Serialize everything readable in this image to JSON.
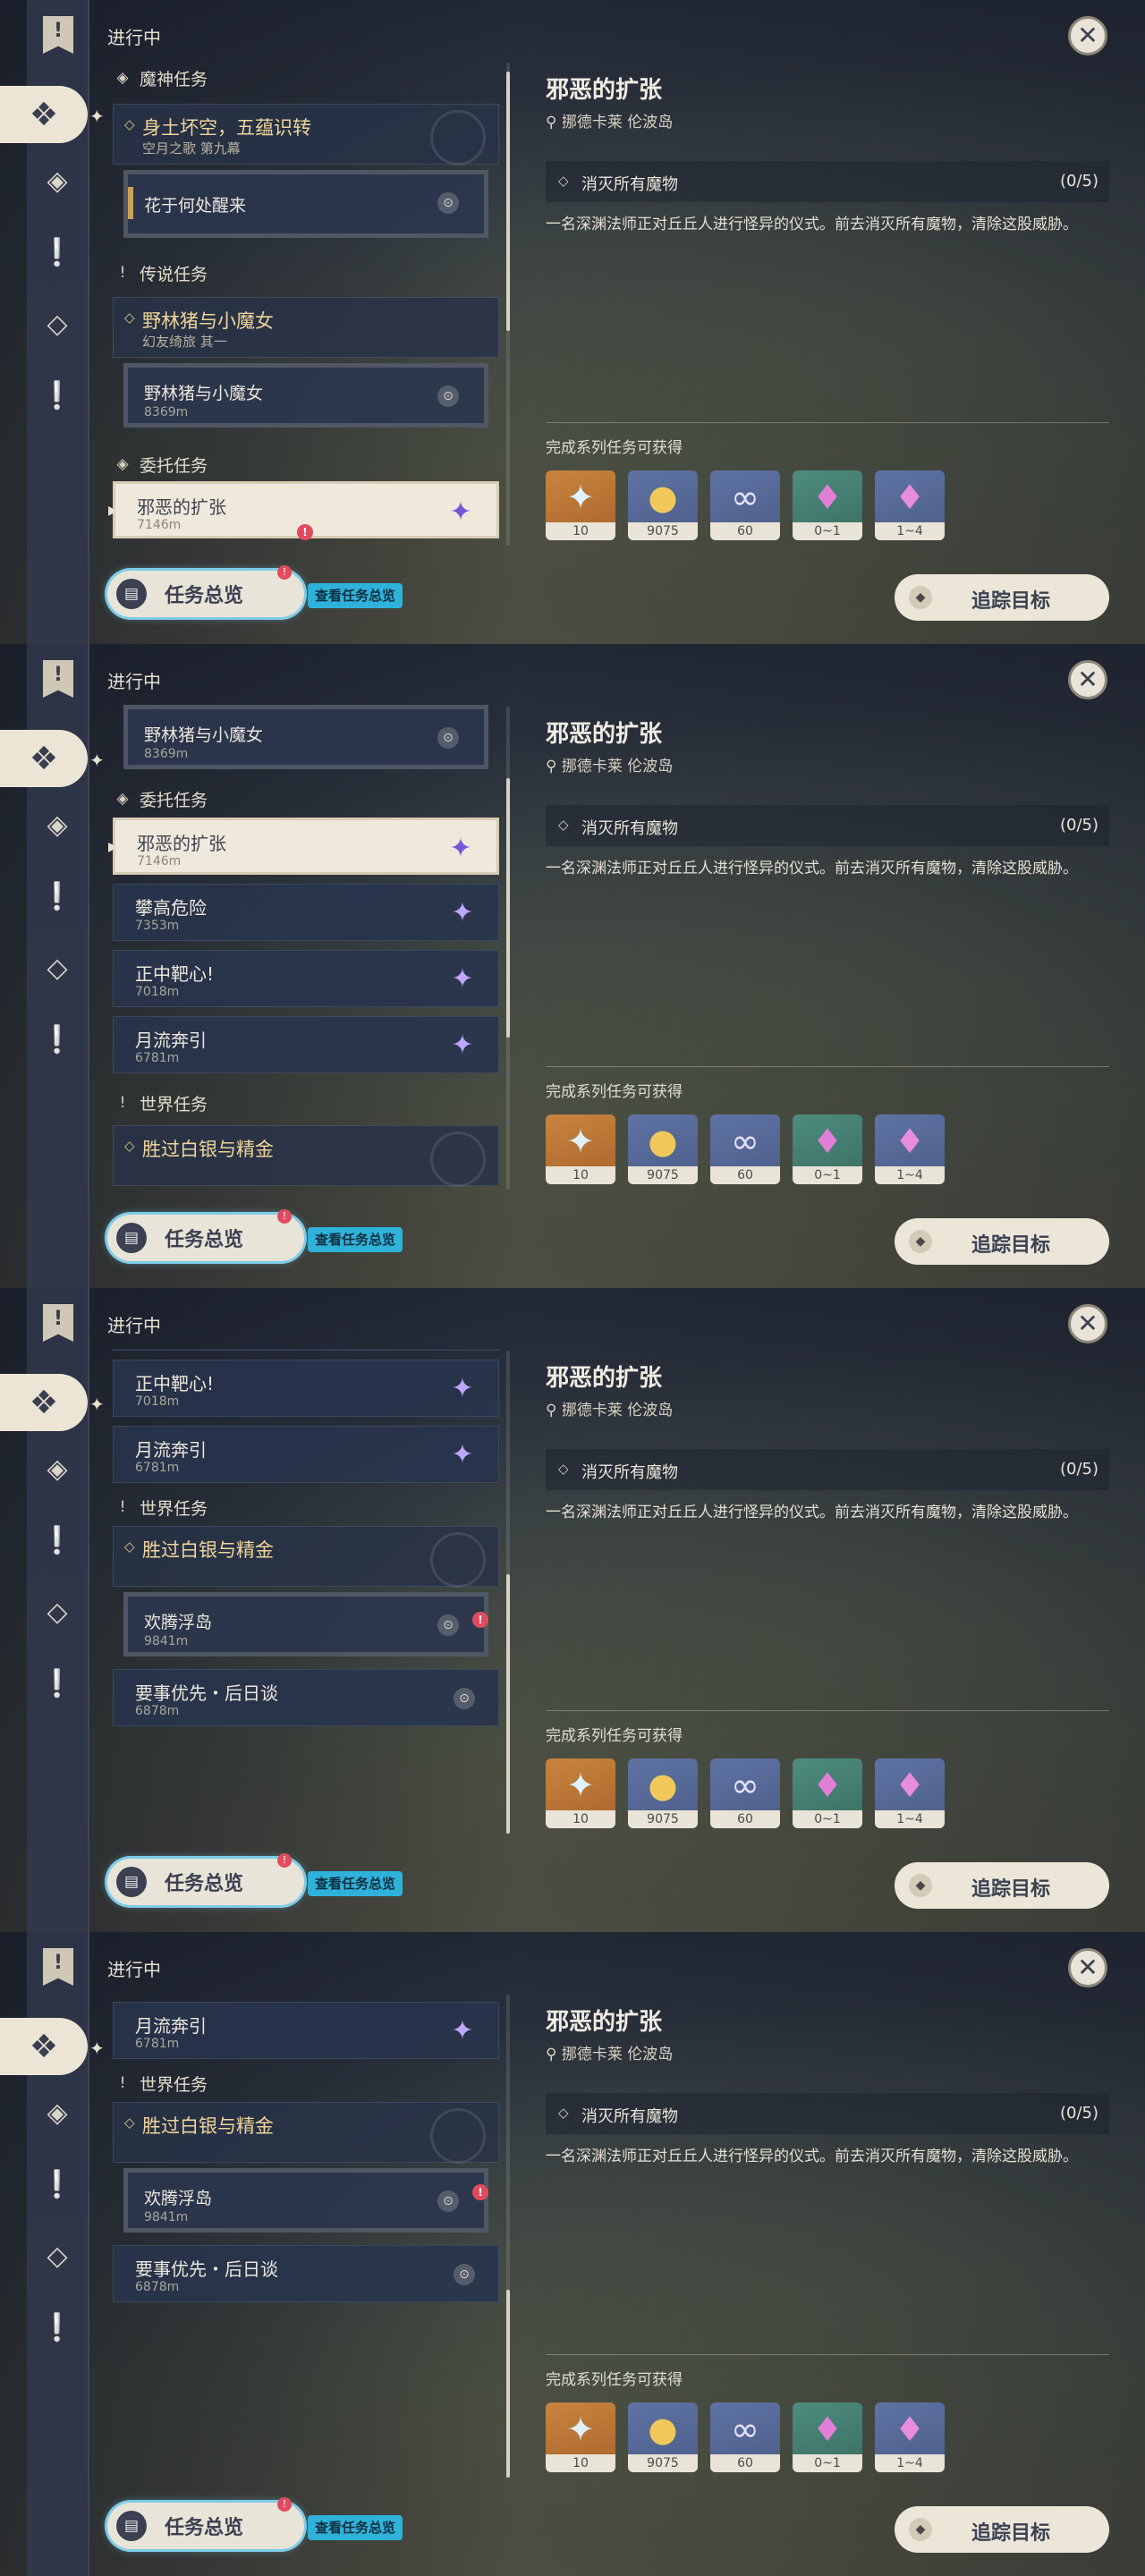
{
  "header": {
    "status": "进行中"
  },
  "nav": {
    "bookmark_icon": "bookmark-icon",
    "icons": [
      "all-quests-icon",
      "archon-quest-icon",
      "story-quest-icon",
      "commission-quest-icon",
      "world-quest-icon"
    ]
  },
  "sections": {
    "archon": "魔神任务",
    "legend": "传说任务",
    "commission": "委托任务",
    "world": "世界任务"
  },
  "quests": {
    "archon_main": {
      "title": "身土坏空，五蕴识转",
      "subtitle": "空月之歌 第九幕"
    },
    "archon_sub": {
      "title": "花于何处醒来"
    },
    "legend_main": {
      "title": "野林猪与小魔女",
      "subtitle": "幻友绮旅 其一"
    },
    "legend_sub": {
      "title": "野林猪与小魔女",
      "distance": "8369m"
    },
    "comm1": {
      "title": "邪恶的扩张",
      "distance": "7146m"
    },
    "comm2": {
      "title": "攀高危险",
      "distance": "7353m"
    },
    "comm3": {
      "title": "正中靶心!",
      "distance": "7018m"
    },
    "comm4": {
      "title": "月流奔引",
      "distance": "6781m"
    },
    "world_main": {
      "title": "胜过白银与精金"
    },
    "world_sub": {
      "title": "欢腾浮岛",
      "distance": "9841m"
    },
    "world_other": {
      "title": "要事优先・后日谈",
      "distance": "6878m"
    }
  },
  "buttons": {
    "overview": "任务总览",
    "overview_tip": "查看任务总览",
    "track": "追踪目标",
    "close": "✕",
    "new_badge": "!"
  },
  "detail": {
    "title": "邪恶的扩张",
    "location": "挪德卡莱 伦波岛",
    "objective": "消灭所有魔物",
    "progress": "(0/5)",
    "description": "一名深渊法师正对丘丘人进行怪异的仪式。前去消灭所有魔物，清除这股威胁。",
    "reward_title": "完成系列任务可获得",
    "rewards": [
      {
        "name": "primogem-icon",
        "qty": "10"
      },
      {
        "name": "mora-icon",
        "qty": "9075"
      },
      {
        "name": "companionship-exp-icon",
        "qty": "60"
      },
      {
        "name": "ore-icon",
        "qty": "0~1"
      },
      {
        "name": "crystal-icon",
        "qty": "1~4"
      }
    ]
  },
  "colors": {
    "accent_gold": "#f0d59a",
    "panel": "#2d3447",
    "highlight_blue": "#2fb2da"
  }
}
